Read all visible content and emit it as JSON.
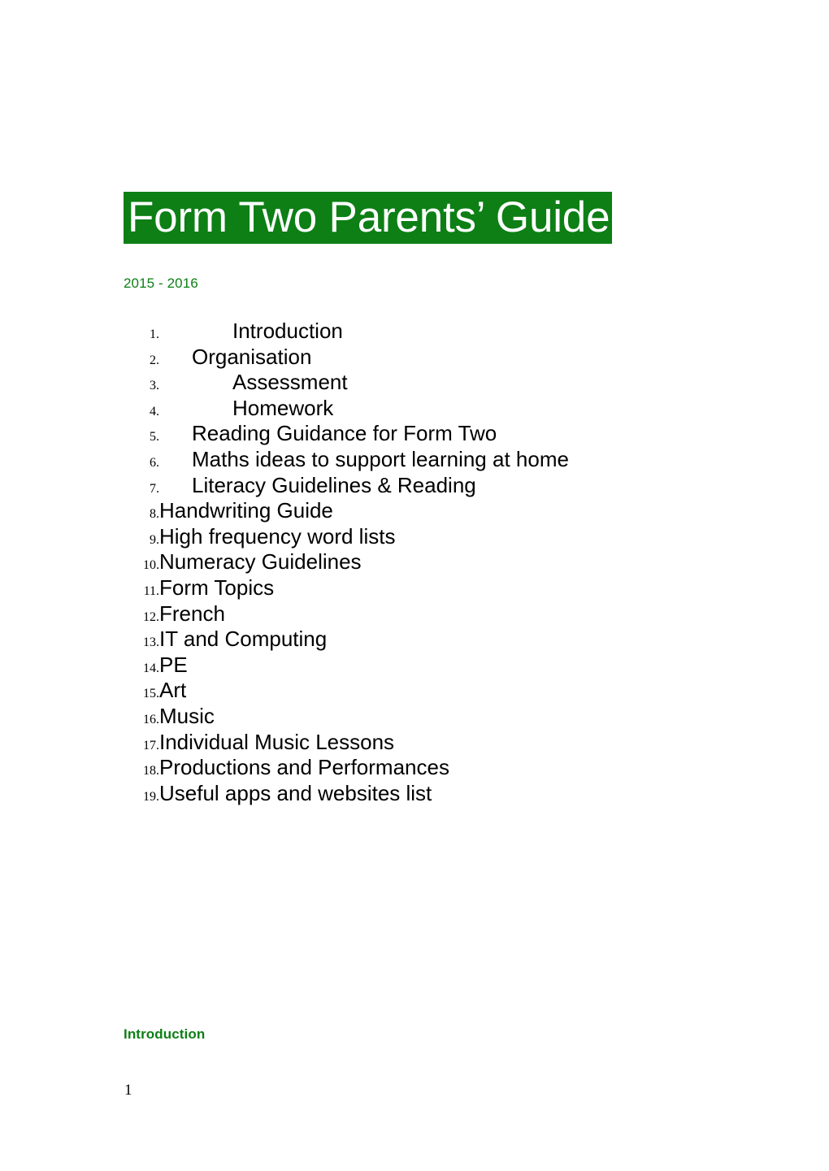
{
  "document": {
    "title": "Form Two Parents’ Guide",
    "subtitle": "2015 - 2016",
    "accent_color": "#0d7f15",
    "title_background": "#0d7f15",
    "title_text_color": "#ffffff"
  },
  "contents": {
    "items": [
      {
        "number": "1.",
        "label": "Introduction",
        "indent": "large"
      },
      {
        "number": "2.",
        "label": "Organisation",
        "indent": "small"
      },
      {
        "number": "3.",
        "label": "Assessment",
        "indent": "large"
      },
      {
        "number": "4.",
        "label": "Homework",
        "indent": "large"
      },
      {
        "number": "5.",
        "label": "Reading Guidance for Form Two",
        "indent": "small"
      },
      {
        "number": "6.",
        "label": "Maths ideas to support learning at home",
        "indent": "small"
      },
      {
        "number": "7.",
        "label": "Literacy Guidelines & Reading",
        "indent": "small"
      },
      {
        "number": "8.",
        "label": "Handwriting Guide",
        "indent": "none"
      },
      {
        "number": "9.",
        "label": "High frequency word lists",
        "indent": "none"
      },
      {
        "number": "10.",
        "label": "Numeracy Guidelines",
        "indent": "none"
      },
      {
        "number": "11.",
        "label": "Form Topics",
        "indent": "none"
      },
      {
        "number": "12.",
        "label": "French",
        "indent": "none"
      },
      {
        "number": "13.",
        "label": "IT and Computing",
        "indent": "none"
      },
      {
        "number": "14.",
        "label": "PE",
        "indent": "none"
      },
      {
        "number": "15.",
        "label": "Art",
        "indent": "none"
      },
      {
        "number": "16.",
        "label": "Music",
        "indent": "none"
      },
      {
        "number": "17.",
        "label": "Individual Music Lessons",
        "indent": "none"
      },
      {
        "number": "18.",
        "label": "Productions and Performances",
        "indent": "none"
      },
      {
        "number": "19.",
        "label": "Useful apps and websites list",
        "indent": "none"
      }
    ]
  },
  "section": {
    "heading": "Introduction"
  },
  "footer": {
    "page_number": "1"
  }
}
